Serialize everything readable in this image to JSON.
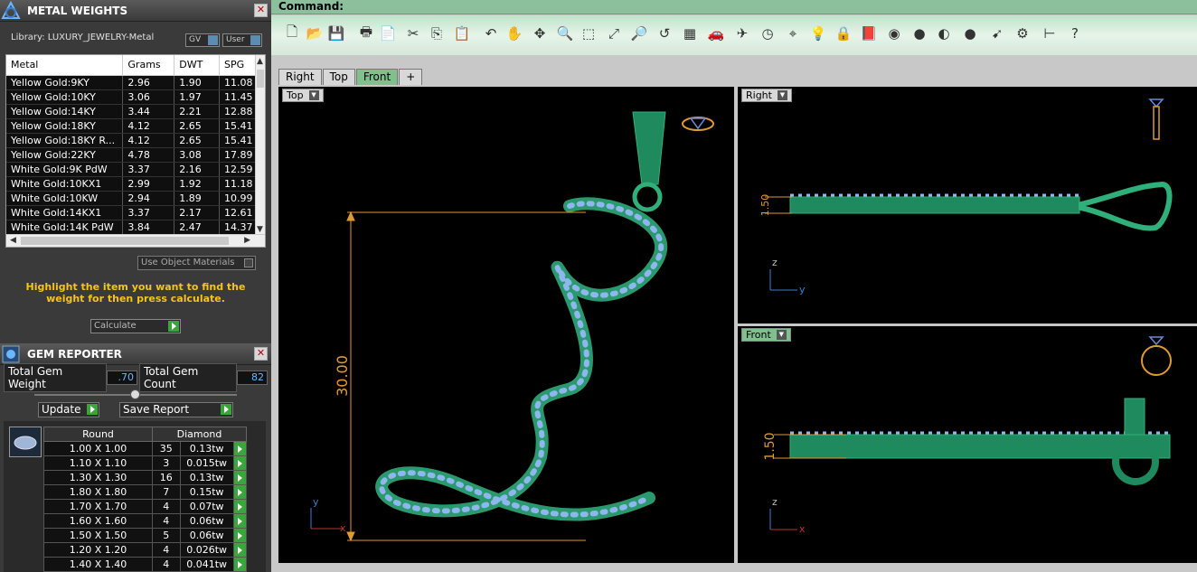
{
  "metal_panel": {
    "title": "METAL WEIGHTS",
    "library_label": "Library: LUXURY_JEWELRY-Metal",
    "gv_label": "GV",
    "user_label": "User",
    "columns": [
      "Metal",
      "Grams",
      "DWT",
      "SPG"
    ],
    "rows": [
      [
        "Yellow Gold:9KY",
        "2.96",
        "1.90",
        "11.08"
      ],
      [
        "Yellow Gold:10KY",
        "3.06",
        "1.97",
        "11.45"
      ],
      [
        "Yellow Gold:14KY",
        "3.44",
        "2.21",
        "12.88"
      ],
      [
        "Yellow Gold:18KY",
        "4.12",
        "2.65",
        "15.41"
      ],
      [
        "Yellow Gold:18KY R...",
        "4.12",
        "2.65",
        "15.41"
      ],
      [
        "Yellow Gold:22KY",
        "4.78",
        "3.08",
        "17.89"
      ],
      [
        "White Gold:9K PdW",
        "3.37",
        "2.16",
        "12.59"
      ],
      [
        "White Gold:10KX1",
        "2.99",
        "1.92",
        "11.18"
      ],
      [
        "White Gold:10KW",
        "2.94",
        "1.89",
        "10.99"
      ],
      [
        "White Gold:14KX1",
        "3.37",
        "2.17",
        "12.61"
      ],
      [
        "White Gold:14K PdW",
        "3.84",
        "2.47",
        "14.37"
      ]
    ],
    "use_object_materials": "Use Object Materials",
    "hint": "Highlight the item you want to find the weight for then press calculate.",
    "calculate_label": "Calculate"
  },
  "gem_panel": {
    "title": "GEM REPORTER",
    "total_weight_label": "Total Gem Weight",
    "total_weight_value": ".70",
    "total_count_label": "Total Gem Count",
    "total_count_value": "82",
    "update_label": "Update",
    "save_report_label": "Save Report",
    "header_shape": "Round",
    "header_material": "Diamond",
    "rows": [
      [
        "1.00 X 1.00",
        "35",
        "0.13tw"
      ],
      [
        "1.10 X 1.10",
        "3",
        "0.015tw"
      ],
      [
        "1.30 X 1.30",
        "16",
        "0.13tw"
      ],
      [
        "1.80 X 1.80",
        "7",
        "0.15tw"
      ],
      [
        "1.70 X 1.70",
        "4",
        "0.07tw"
      ],
      [
        "1.60 X 1.60",
        "4",
        "0.06tw"
      ],
      [
        "1.50 X 1.50",
        "5",
        "0.06tw"
      ],
      [
        "1.20 X 1.20",
        "4",
        "0.026tw"
      ],
      [
        "1.40 X 1.40",
        "4",
        "0.041tw"
      ]
    ]
  },
  "command": {
    "label": "Command:"
  },
  "toolbar": {
    "icons": [
      "new-file-icon",
      "open-folder-icon",
      "save-icon",
      "print-icon",
      "properties-icon",
      "cut-icon",
      "copy-icon",
      "paste-icon",
      "undo-icon",
      "pan-icon",
      "rotate-view-icon",
      "zoom-icon",
      "zoom-window-icon",
      "zoom-extents-icon",
      "zoom-selected-icon",
      "undo-view-icon",
      "four-viewports-icon",
      "car-icon",
      "plane-icon",
      "clock-icon",
      "snap-icon",
      "light-bulb-icon",
      "lock-icon",
      "layer-icon",
      "color-wheel-icon",
      "render-sphere-icon",
      "metal-sphere-icon",
      "blue-sphere-icon",
      "light-cone-icon",
      "gear-icon",
      "grid-snap-icon",
      "help-icon"
    ],
    "glyphs": [
      "🗋",
      "📂",
      "💾",
      "🖶",
      "📄",
      "✂",
      "⎘",
      "📋",
      "↶",
      "✋",
      "✥",
      "🔍",
      "⬚",
      "⤢",
      "🔎",
      "↺",
      "▦",
      "🚗",
      "✈",
      "◷",
      "⌖",
      "💡",
      "🔒",
      "📕",
      "◉",
      "●",
      "◐",
      "●",
      "➹",
      "⚙",
      "⊢",
      "?"
    ]
  },
  "tabs": [
    "Right",
    "Top",
    "Front"
  ],
  "active_tab": "Front",
  "add_tab_label": "+",
  "viewports": {
    "top": {
      "label": "Top",
      "dimension": "30.00",
      "axis_x": "x",
      "axis_y": "y"
    },
    "right": {
      "label": "Right",
      "dimension": "1.50",
      "axis_z": "z",
      "axis_y": "y"
    },
    "front": {
      "label": "Front",
      "dimension": "1.50",
      "axis_z": "z",
      "axis_x": "x"
    }
  }
}
